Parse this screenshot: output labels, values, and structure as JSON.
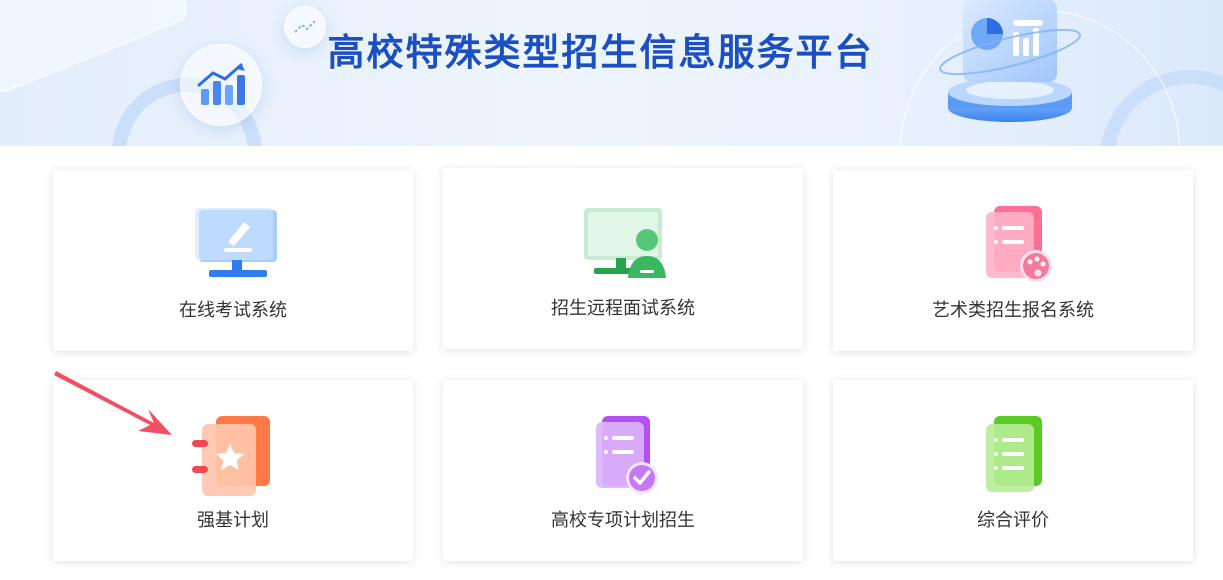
{
  "banner": {
    "title": "高校特殊类型招生信息服务平台"
  },
  "cards": [
    {
      "label": "在线考试系统",
      "icon": "monitor-pen-icon",
      "color": "#3a8ef6"
    },
    {
      "label": "招生远程面试系统",
      "icon": "monitor-person-icon",
      "color": "#2fb35a"
    },
    {
      "label": "艺术类招生报名系统",
      "icon": "document-palette-icon",
      "color": "#f2587f"
    },
    {
      "label": "强基计划",
      "icon": "notebook-star-icon",
      "color": "#f36a3c"
    },
    {
      "label": "高校专项计划招生",
      "icon": "document-check-icon",
      "color": "#b44ff0"
    },
    {
      "label": "综合评价",
      "icon": "document-list-icon",
      "color": "#58c827"
    }
  ],
  "colors": {
    "title": "#1b4fc4",
    "arrow": "#f24f63"
  }
}
